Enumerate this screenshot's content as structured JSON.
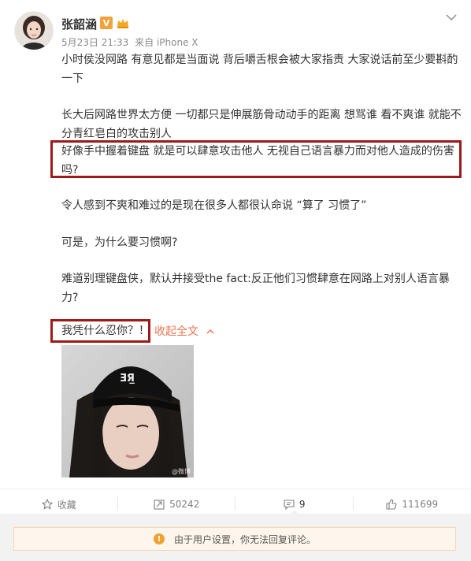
{
  "user": {
    "name": "张韶涵",
    "verified_badge": "V",
    "avatar_icon": "avatar",
    "member_icon": "member-crown-icon"
  },
  "meta": {
    "date": "5月23日 21:33",
    "source": "来自 iPhone X"
  },
  "post": {
    "paragraphs": [
      "小时侯没网路 有意见都是当面说 背后嚼舌根会被大家指责 大家说话前至少要斟酌一下",
      "长大后网路世界太方便 一切都只是伸展筋骨动动手的距离 想骂谁 看不爽谁 就能不分青红皂白的攻击别人",
      "好像手中握着键盘 就是可以肆意攻击他人 无视自己语言暴力而对他人造成的伤害吗?",
      "令人感到不爽和难过的是现在很多人都很认命说 “算了 习惯了”",
      "可是，为什么要习惯啊?",
      "难道别理键盘侠，默认并接受the fact:反正他们习惯肆意在网路上对别人语言暴力?",
      "我凭什么忍你？！"
    ],
    "collapse_label": "收起全文",
    "image_watermark": "@微博"
  },
  "actions": {
    "favorite": "收藏",
    "repost": "50242",
    "comment": "9",
    "like": "111699"
  },
  "comments": {
    "notice": "由于用户设置，你无法回复评论。"
  },
  "colors": {
    "highlight_border": "#9e1a1a",
    "link": "#eb7350",
    "notice_bg": "#fef6ec",
    "warning": "#f0a131"
  }
}
